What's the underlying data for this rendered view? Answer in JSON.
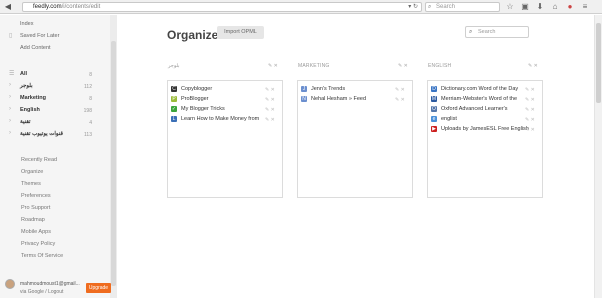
{
  "browser": {
    "url_host": "feedly.com",
    "url_path": "/i/contents/edit",
    "search_placeholder": "Search"
  },
  "sidebar": {
    "top_items": [
      {
        "label": "Index",
        "icon": ""
      },
      {
        "label": "Saved For Later",
        "icon": "bookmark-icon"
      },
      {
        "label": "Add Content",
        "icon": ""
      }
    ],
    "categories": [
      {
        "label": "All",
        "count": "8",
        "bold": true
      },
      {
        "label": "بلوجر",
        "count": "112",
        "bold": true
      },
      {
        "label": "Marketing",
        "count": "8",
        "bold": true
      },
      {
        "label": "English",
        "count": "198",
        "bold": true
      },
      {
        "label": "تقنية",
        "count": "4",
        "bold": true
      },
      {
        "label": "قنوات يوتيوب تقنية",
        "count": "113",
        "bold": true
      }
    ],
    "menu": [
      {
        "label": "Recently Read"
      },
      {
        "label": "Organize"
      },
      {
        "label": "Themes"
      },
      {
        "label": "Preferences"
      },
      {
        "label": "Pro Support"
      },
      {
        "label": "Roadmap"
      },
      {
        "label": "Mobile Apps"
      },
      {
        "label": "Privacy Policy"
      },
      {
        "label": "Terms Of Service"
      }
    ],
    "account": {
      "email": "mahmoudmoust1@gmail...",
      "sub": "via Google / Logout",
      "upgrade_label": "Upgrade"
    }
  },
  "main": {
    "title": "Organize",
    "import_label": "Import OPML",
    "search_placeholder": "Search",
    "categories": [
      {
        "name": "بلوجر",
        "feeds": [
          {
            "label": "Copyblogger",
            "icon": "C",
            "color": "#333333"
          },
          {
            "label": "ProBlogger",
            "icon": "P",
            "color": "#9bbc3a"
          },
          {
            "label": "My Blogger Tricks",
            "icon": "✓",
            "color": "#3ba43b"
          },
          {
            "label": "Learn How to Make Money from",
            "icon": "L",
            "color": "#3b6fb6"
          }
        ]
      },
      {
        "name": "MARKETING",
        "feeds": [
          {
            "label": "Jenn's Trends",
            "icon": "J",
            "color": "#6b8fcf"
          },
          {
            "label": "Nehal Hesham » Feed",
            "icon": "N",
            "color": "#6b8fcf"
          }
        ]
      },
      {
        "name": "ENGLISH",
        "feeds": [
          {
            "label": "Dictionary.com Word of the Day",
            "icon": "D",
            "color": "#3a75c4"
          },
          {
            "label": "Merriam-Webster's Word of the",
            "icon": "M",
            "color": "#2c5aa0"
          },
          {
            "label": "Oxford Advanced Learner's",
            "icon": "O",
            "color": "#5577aa"
          },
          {
            "label": "englist",
            "icon": "e",
            "color": "#4a90d9"
          },
          {
            "label": "Uploads by JamesESL Free English",
            "icon": "▶",
            "color": "#cc2020"
          }
        ]
      }
    ]
  }
}
